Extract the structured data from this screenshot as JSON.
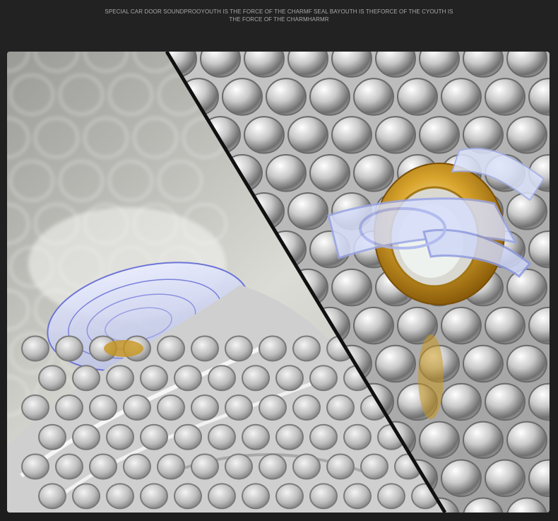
{
  "caption": {
    "line1": "SPECIAL CAR DOOR SOUNDPROOYOUTH IS THE FORCE OF THE CHARMF SEAL BAYOUTH IS THEFORCE OF THE CYOUTH IS",
    "line2": "THE FORCE OF THE CHARMHARMR"
  },
  "photo": {
    "left_panel": "blurred-silver-bubble-foil-with-suction-cup",
    "right_panel": "silver-bubble-foil-with-gold-grommet-and-clear-clip",
    "accent_gold": "#c8961e",
    "accent_clip": "#b9c6f2",
    "divider_color": "#101010"
  }
}
